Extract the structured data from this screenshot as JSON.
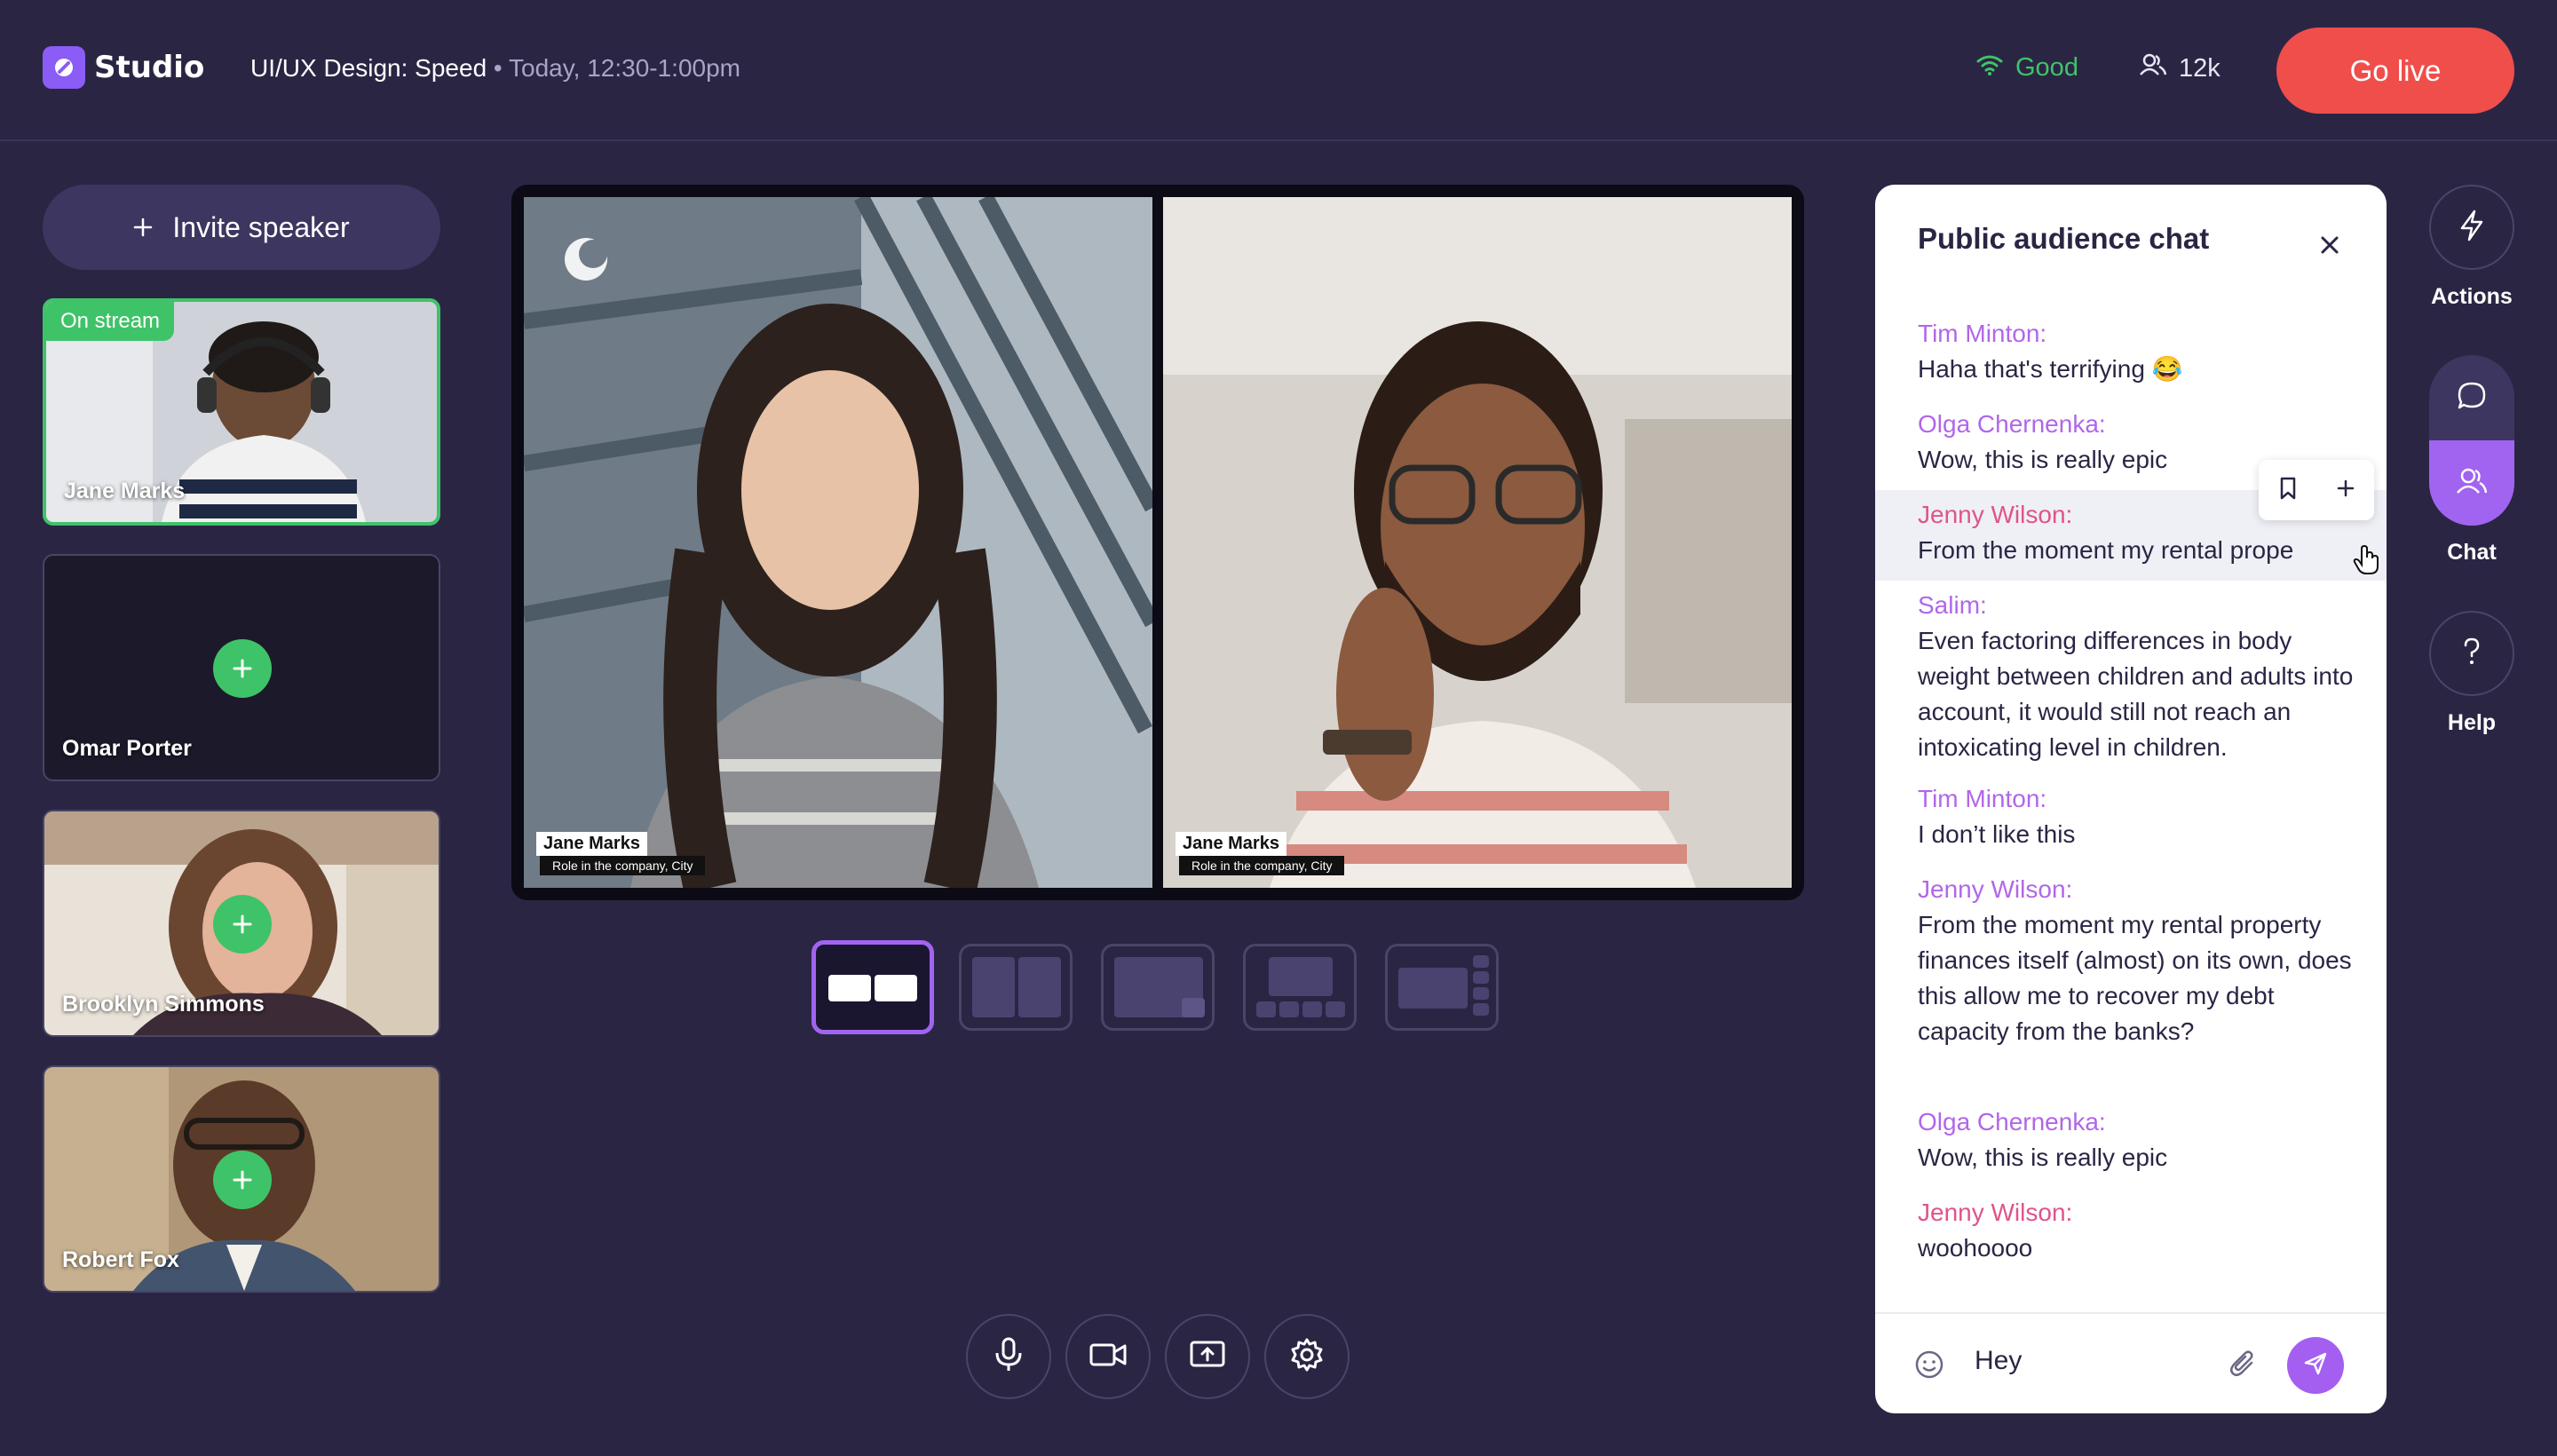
{
  "app": {
    "name": "Studio",
    "session_title": "UI/UX Design: Speed",
    "session_time": " • Today, 12:30-1:00pm",
    "connection": "Good",
    "viewer_count": "12k",
    "go_live_label": "Go live"
  },
  "speakers": {
    "invite_label": "Invite speaker",
    "on_stream_badge": "On stream",
    "items": [
      {
        "name": "Jane Marks",
        "on_stream": true
      },
      {
        "name": "Omar Porter",
        "on_stream": false
      },
      {
        "name": "Brooklyn Simmons",
        "on_stream": false
      },
      {
        "name": "Robert Fox",
        "on_stream": false
      }
    ]
  },
  "stage": {
    "tiles": [
      {
        "name": "Jane Marks",
        "role": "Role in the company, City"
      },
      {
        "name": "Jane Marks",
        "role": "Role in the company, City"
      }
    ]
  },
  "chat": {
    "title": "Public audience chat",
    "messages": [
      {
        "author": "Tim Minton:",
        "text": "Haha that's terrifying 😂"
      },
      {
        "author": "Olga Chernenka:",
        "text": "Wow, this is really epic"
      },
      {
        "author": "Jenny Wilson:",
        "text": "From the moment my rental prope"
      },
      {
        "author": "Salim:",
        "text": "Even factoring differences in body weight between children and adults into account, it would still not reach an intoxicating level in children."
      },
      {
        "author": "Tim Minton:",
        "text": "I don’t like this"
      },
      {
        "author": "Jenny Wilson:",
        "text": "From the moment my rental property finances itself (almost) on its own, does this allow me to recover my debt capacity from the banks?"
      },
      {
        "author": "Olga Chernenka:",
        "text": "Wow, this is really epic"
      },
      {
        "author": "Jenny Wilson:",
        "text": "woohoooo"
      }
    ],
    "input_value": "Hey"
  },
  "rail": {
    "actions_label": "Actions",
    "chat_label": "Chat",
    "help_label": "Help"
  },
  "colors": {
    "background": "#2b2544",
    "accent": "#a164f0",
    "live": "#f04e4b",
    "good": "#3fc368"
  }
}
